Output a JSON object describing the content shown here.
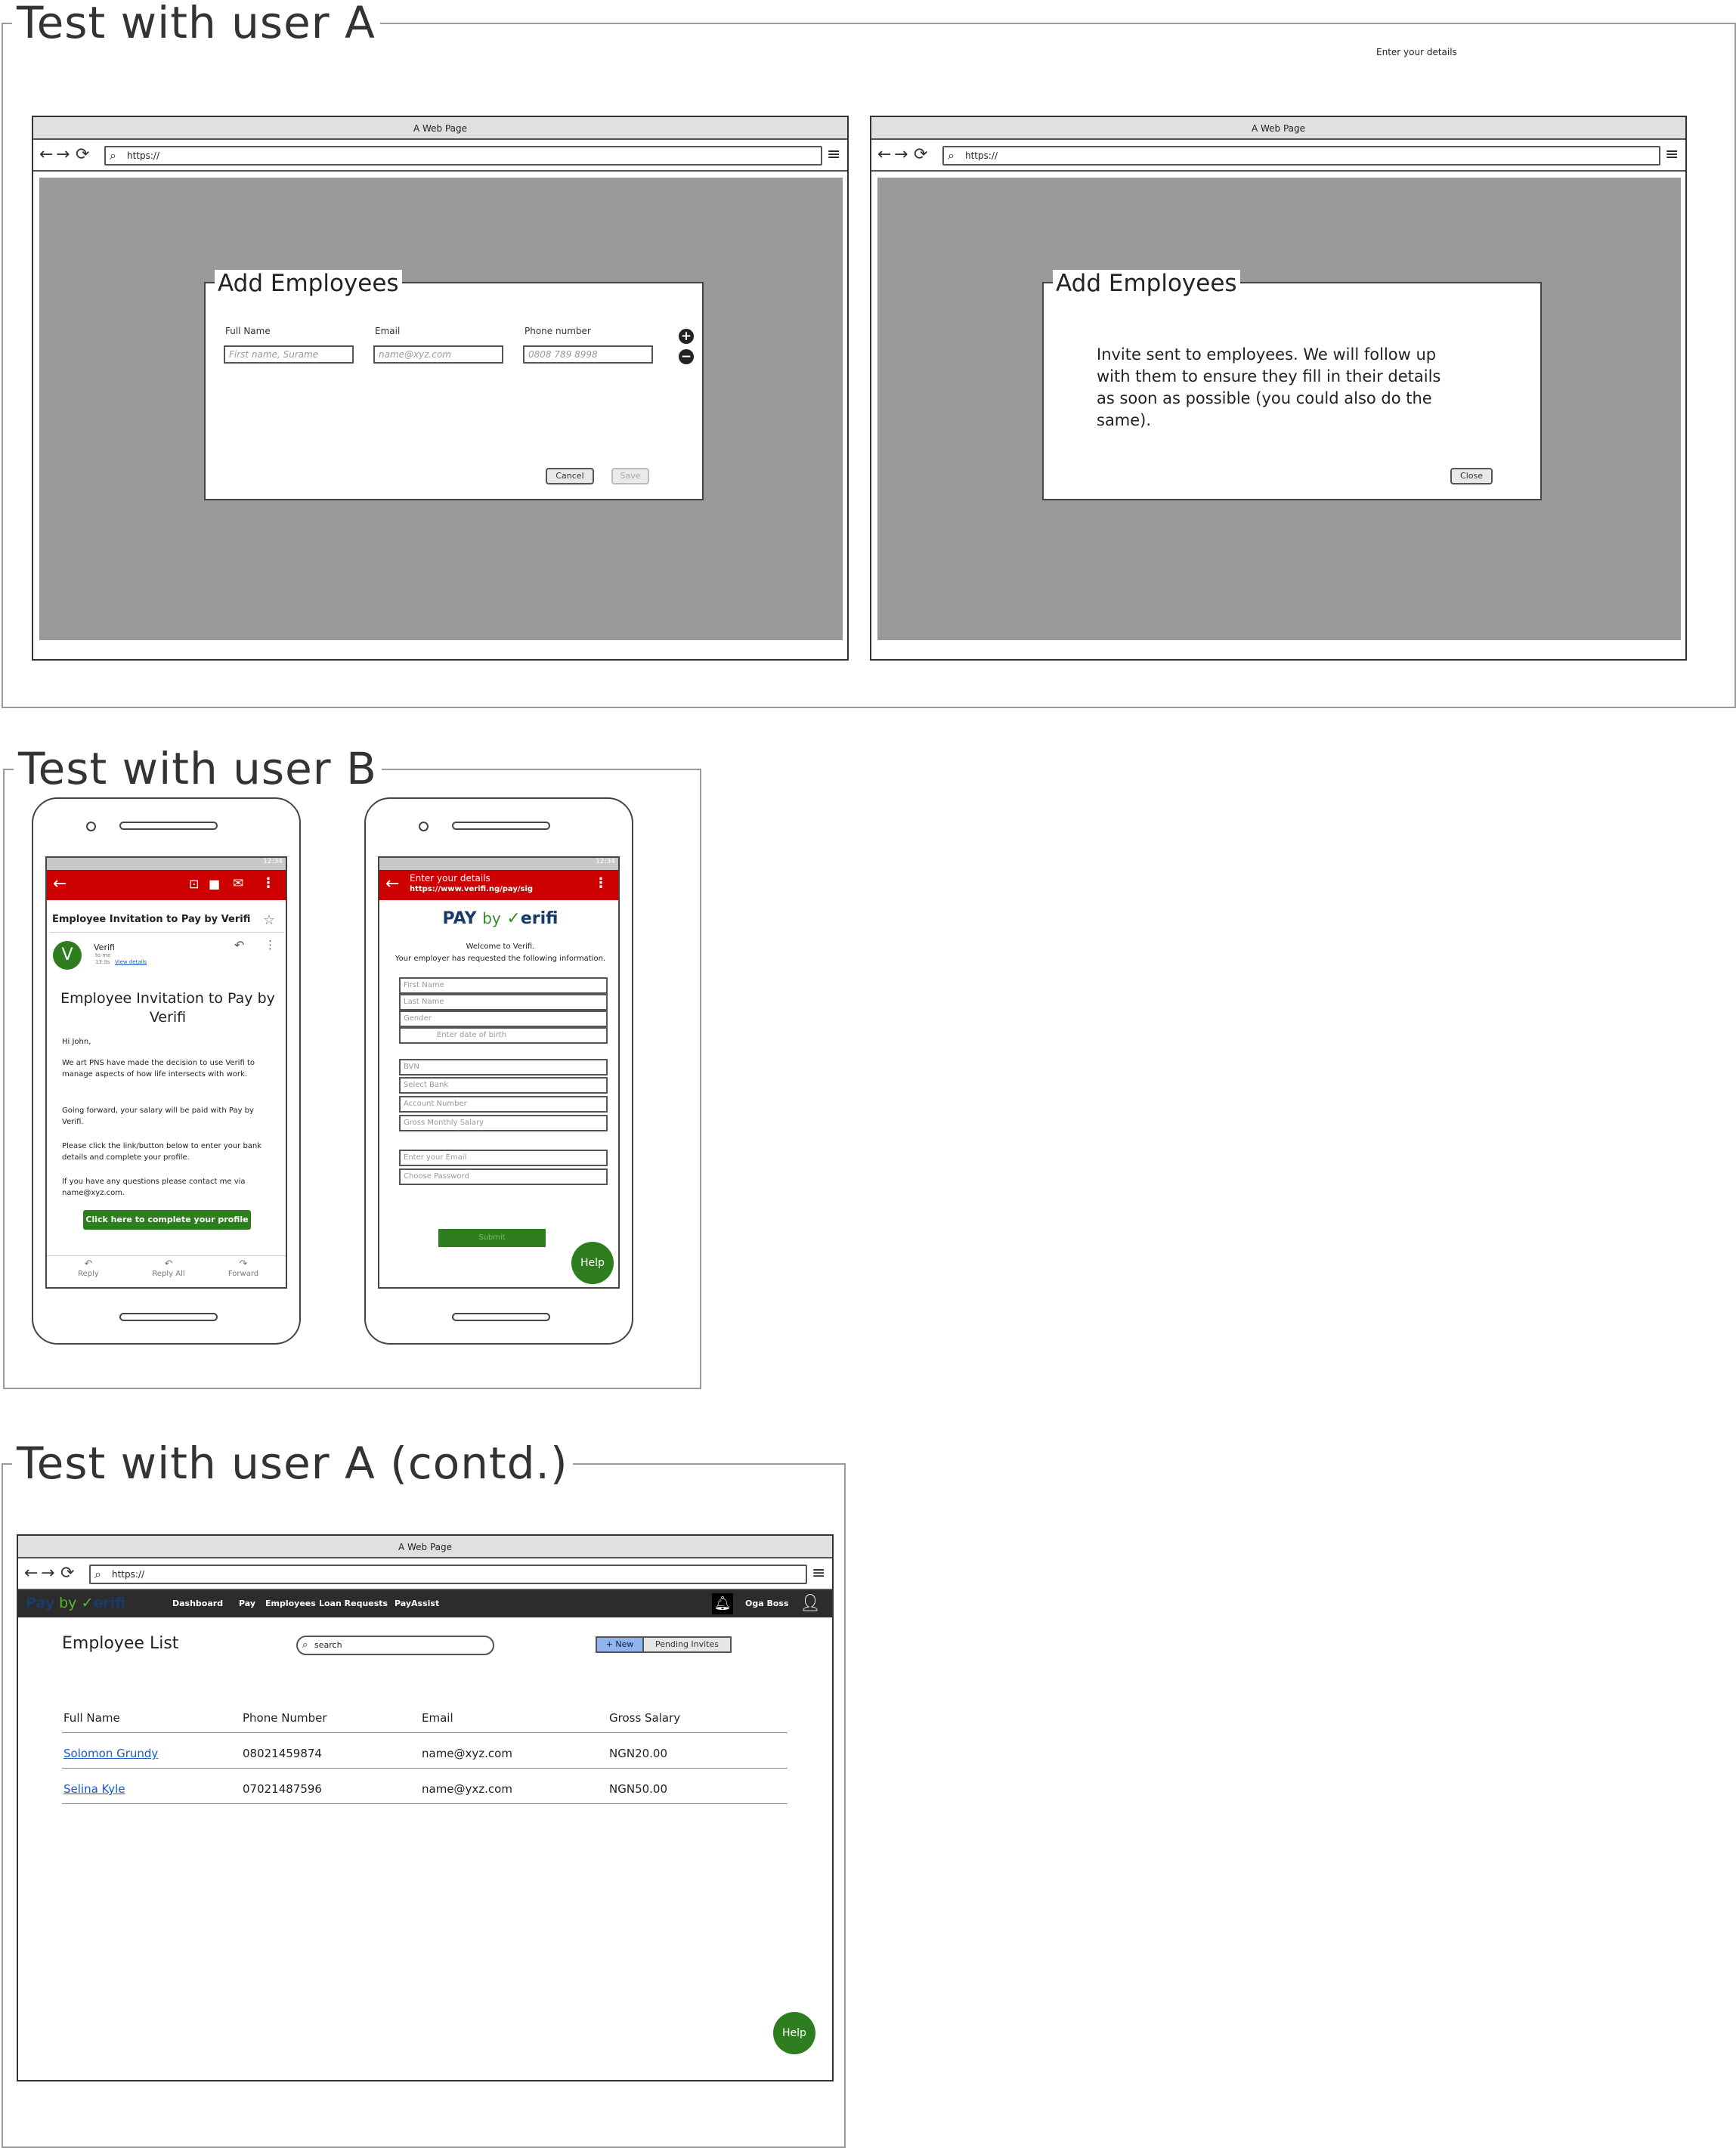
{
  "sectionA": {
    "title": "Test with user A",
    "note": "Enter your details",
    "browser1": {
      "title": "A Web Page",
      "url": "https://",
      "dialog": {
        "title": "Add Employees",
        "labels": {
          "full_name": "Full Name",
          "email": "Email",
          "phone": "Phone number"
        },
        "placeholders": {
          "full_name": "First name, Surame",
          "email": "name@xyz.com",
          "phone": "0808 789 8998"
        },
        "cancel": "Cancel",
        "save": "Save"
      }
    },
    "browser2": {
      "title": "A Web Page",
      "url": "https://",
      "dialog": {
        "title": "Add Employees",
        "message": "Invite sent to employees. We will follow up with them to ensure they fill in their details as soon as possible (you could also do the same).",
        "close": "Close"
      }
    }
  },
  "sectionB": {
    "title": "Test with user B",
    "phone1": {
      "status_time": "12:34",
      "subject": "Employee Invitation to Pay by Verifi",
      "avatar_letter": "V",
      "sender": "Verifi",
      "to": "to me",
      "time": "13:3s",
      "view_details": "View details",
      "heading": "Employee Invitation to Pay by Verifi",
      "greeting": "Hi John,",
      "p1": "We art PNS have made the decision to use Verifi to manage aspects of how life intersects with work.",
      "p2": "Going forward, your salary will be paid with Pay by Verifi.",
      "p3": "Please click the link/button below to enter your bank details and complete your profile.",
      "p4": "If you have any questions please contact me via name@xyz.com.",
      "cta": "Click here to complete your profile",
      "actions": [
        "Reply",
        "Reply All",
        "Forward"
      ]
    },
    "phone2": {
      "status_time": "12:34",
      "bar_title": "Enter your details",
      "bar_url": "https://www.verifi.ng/pay/sig",
      "logo_pay": "PAY",
      "logo_by": "by",
      "logo_verifi": "erifi",
      "welcome": "Welcome to Verifi.",
      "request": "Your employer has requested the following information.",
      "fields1": [
        "First Name",
        "Last Name",
        "Gender"
      ],
      "dob": "Enter date of birth",
      "fields2": [
        "BVN",
        "Select Bank",
        "Account Number",
        "Gross Monthly Salary"
      ],
      "fields3": [
        "Enter your Email",
        "Choose Password"
      ],
      "submit": "Submit",
      "help": "Help"
    }
  },
  "sectionC": {
    "title": "Test with user A (contd.)",
    "browser": {
      "title": "A Web Page",
      "url": "https://",
      "nav": {
        "logo_pay": "Pay",
        "logo_by": "by",
        "logo_verifi": "erifi",
        "items": [
          "Dashboard",
          "Pay",
          "Employees",
          "Loan Requests",
          "PayAssist"
        ],
        "user": "Oga Boss"
      },
      "page_title": "Employee List",
      "search_placeholder": "search",
      "new_button": "+ New",
      "pending_button": "Pending Invites",
      "table": {
        "headers": [
          "Full Name",
          "Phone Number",
          "Email",
          "Gross Salary"
        ],
        "rows": [
          [
            "Solomon Grundy",
            "08021459874",
            "name@xyz.com",
            "NGN20.00"
          ],
          [
            "Selina Kyle",
            "07021487596",
            "name@yxz.com",
            "NGN50.00"
          ]
        ]
      },
      "help": "Help"
    }
  },
  "colors": {
    "red": "#cc0000",
    "green": "#2e7d1e",
    "navy": "#1a3a6a",
    "grey": "#999999"
  }
}
